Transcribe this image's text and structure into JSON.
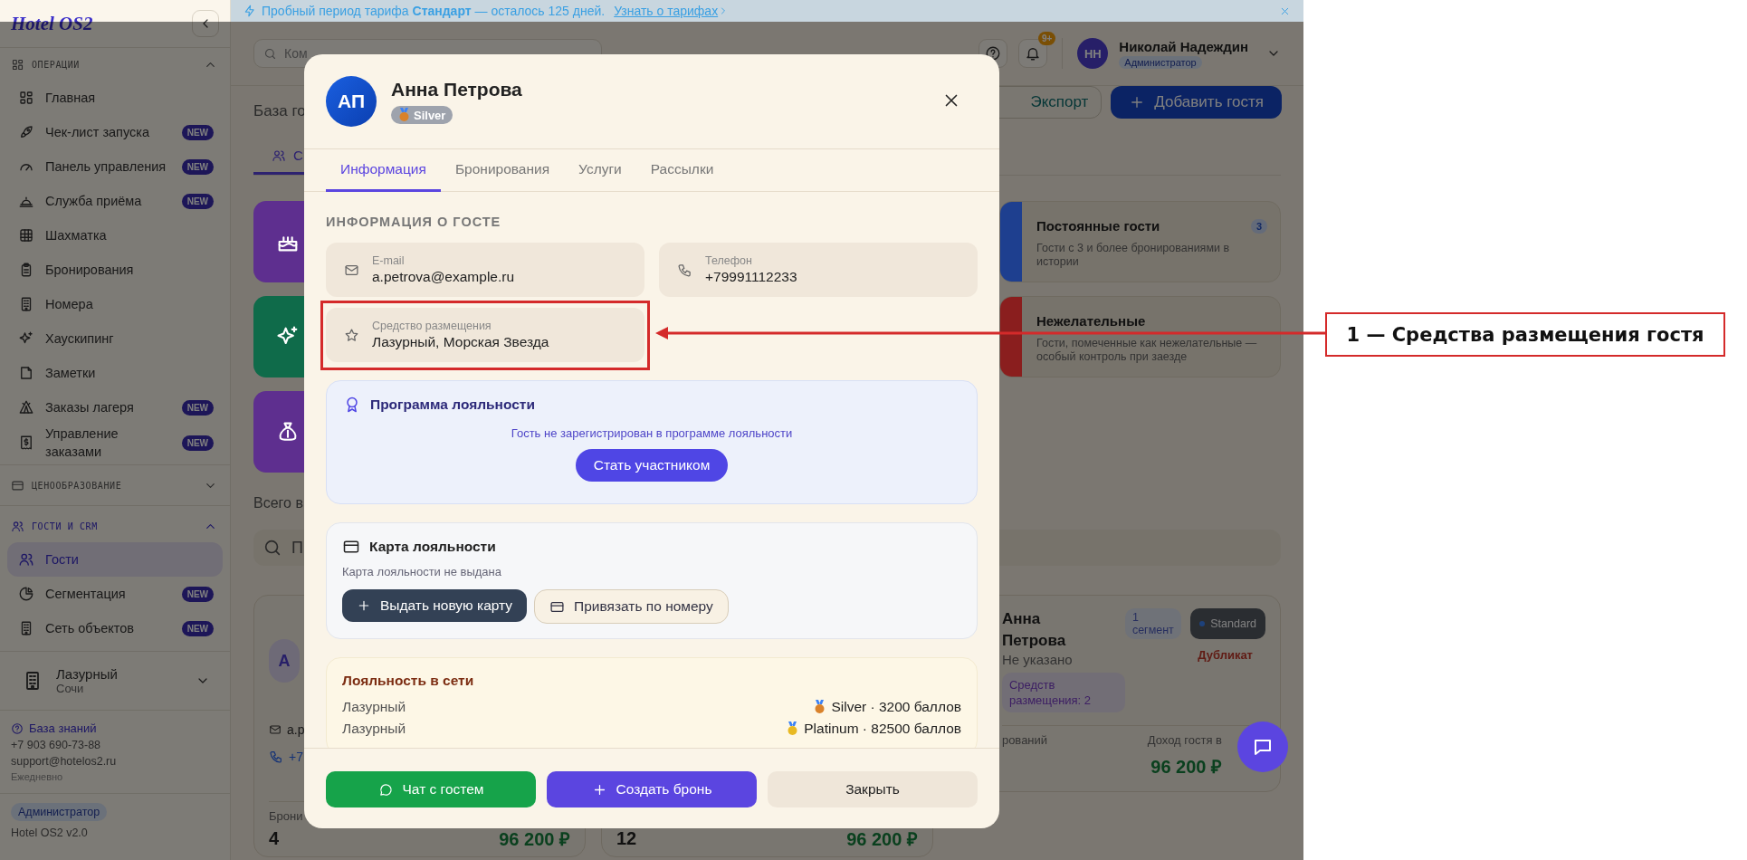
{
  "banner": {
    "text": "Пробный период тарифа **Стандарт** — осталось 125 дней.",
    "link": "Узнать о тарифах"
  },
  "sidebar": {
    "logo": "Hotel OS2",
    "sections": [
      {
        "title": "ОПЕРАЦИИ",
        "active": false,
        "expanded": true,
        "items": [
          {
            "label": "Главная",
            "selected": false
          },
          {
            "label": "Чек-лист запуска",
            "badge": "NEW",
            "selected": false
          },
          {
            "label": "Панель управления",
            "badge": "NEW",
            "selected": false
          },
          {
            "label": "Служба приёма",
            "badge": "NEW",
            "selected": false
          },
          {
            "label": "Шахматка",
            "selected": false
          },
          {
            "label": "Бронирования",
            "selected": false
          },
          {
            "label": "Номера",
            "selected": false
          },
          {
            "label": "Хаускипинг",
            "selected": false
          },
          {
            "label": "Заметки",
            "selected": false
          },
          {
            "label": "Заказы лагеря",
            "badge": "NEW",
            "selected": false
          },
          {
            "label": "Управление заказами",
            "badge": "NEW",
            "selected": false
          }
        ]
      },
      {
        "title": "ЦЕНООБРАЗОВАНИЕ",
        "active": false,
        "expanded": false
      },
      {
        "title": "ГОСТИ И CRM",
        "active": true,
        "expanded": true,
        "items": [
          {
            "label": "Гости",
            "selected": true
          },
          {
            "label": "Сегментация",
            "badge": "NEW",
            "selected": false
          },
          {
            "label": "Сеть объектов",
            "badge": "NEW",
            "selected": false
          }
        ]
      }
    ],
    "property": {
      "name": "Лазурный",
      "city": "Сочи"
    },
    "help": {
      "link": "База знаний",
      "phone": "+7 903 690-73-88",
      "email": "support@hotelos2.ru",
      "hours": "Ежедневно"
    },
    "role": "Администратор",
    "version": "Hotel OS2 v2.0"
  },
  "topbar": {
    "search": "Ком",
    "notifications": "9+",
    "user": {
      "initials": "НН",
      "name": "Николай Надеждин",
      "role": "Администратор"
    }
  },
  "page": {
    "title": "База го",
    "buttons": [
      "Экспорт",
      "Добавить гостя"
    ],
    "tab": "С",
    "segments_left": [
      {
        "color": "#5e2f8f"
      },
      {
        "color": "#0f6b4a"
      },
      {
        "color": "#5e2f8f"
      }
    ],
    "segments_right": [
      {
        "title": "Постоянные гости",
        "count": "3",
        "description": "Гости с 3 и более бронированиями в истории",
        "color": "#1e3f8f"
      },
      {
        "title": "Нежелательные",
        "description": "Гости, помеченные как нежелательные — особый контроль при заезде",
        "color": "#8a1e1e"
      }
    ],
    "total": "Всего в",
    "search": "П",
    "guest_cards": [
      {
        "kind": "contact",
        "avatar": "A",
        "email": "a.p",
        "phone": "+7",
        "stat_label": "Брони",
        "stat": "4",
        "revenue": "96 200 ₽"
      },
      {
        "kind": "stats",
        "stat": "12",
        "revenue": "96 200 ₽"
      },
      {
        "kind": "profile",
        "name": "Анна Петрова",
        "segments": "1 сегмент",
        "plan": "Standard",
        "flag": "Дубликат",
        "subtitle": "Не указано",
        "properties": "Средств размещения: 2",
        "stat_label": "рований",
        "revenue_label": "Доход гостя в",
        "revenue": "96 200 ₽"
      }
    ]
  },
  "modal": {
    "avatar": "АП",
    "name": "Анна Петрова",
    "tier": {
      "label": "Silver",
      "color": "#d9822b"
    },
    "tabs": [
      {
        "label": "Информация",
        "selected": true
      },
      {
        "label": "Бронирования",
        "selected": false
      },
      {
        "label": "Услуги",
        "selected": false
      },
      {
        "label": "Рассылки",
        "selected": false
      }
    ],
    "section_title": "ИНФОРМАЦИЯ О ГОСТЕ",
    "fields": [
      {
        "label": "E-mail",
        "value": "a.petrova@example.ru",
        "highlighted": false
      },
      {
        "label": "Телефон",
        "value": "+79991112233",
        "highlighted": false
      },
      {
        "label": "Средство размещения",
        "value": "Лазурный, Морская Звезда",
        "highlighted": true
      }
    ],
    "loyalty_program": {
      "title": "Программа лояльности",
      "message": "Гость не зарегистрирован в программе лояльности",
      "button": "Стать участником"
    },
    "loyalty_card": {
      "title": "Карта лояльности",
      "message": "Карта лояльности не выдана",
      "buttons": [
        "Выдать новую карту",
        "Привязать по номеру"
      ]
    },
    "network_loyalty": {
      "title": "Лояльность в сети",
      "rows": [
        {
          "property": "Лазурный",
          "color": "#d9822b",
          "status": "Silver · 3200 баллов"
        },
        {
          "property": "Лазурный",
          "color": "#e8b923",
          "status": "Platinum · 82500 баллов"
        }
      ]
    },
    "footer_buttons": [
      {
        "kind": "chat",
        "label": "Чат с гостем"
      },
      {
        "kind": "create",
        "label": "Создать бронь"
      },
      {
        "kind": "close",
        "label": "Закрыть"
      }
    ]
  },
  "annotation": {
    "text": "1 — Средства размещения гостя"
  }
}
